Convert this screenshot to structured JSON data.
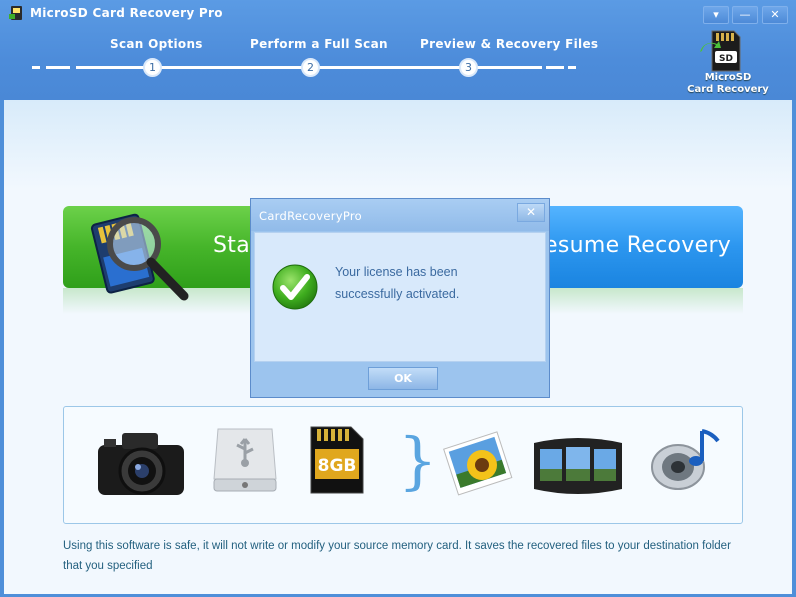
{
  "window": {
    "title": "MicroSD Card Recovery Pro",
    "controls": {
      "menu": "▾",
      "minimize": "—",
      "close": "✕"
    }
  },
  "wizard": {
    "steps": [
      {
        "label": "Scan Options",
        "number": "1"
      },
      {
        "label": "Perform a Full Scan",
        "number": "2"
      },
      {
        "label": "Preview & Recovery Files",
        "number": "3"
      }
    ]
  },
  "product": {
    "line1": "MicroSD",
    "line2": "Card Recovery",
    "logo_text": "SD"
  },
  "actions": {
    "start_label": "Sta",
    "resume_label": "esume Recovery"
  },
  "media": {
    "sd_card_capacity": "8GB",
    "items": [
      "camera-icon",
      "usb-drive-icon",
      "sd-card-icon",
      "photo-icon",
      "film-icon",
      "audio-icon"
    ]
  },
  "notice": "Using this software is safe, it will not write or modify your source memory card. It saves the recovered files to your destination folder that you specified",
  "dialog": {
    "title": "CardRecoveryPro",
    "close": "✕",
    "message_line1": "Your license has been",
    "message_line2": "successfully activated.",
    "ok_label": "OK"
  },
  "colors": {
    "header_blue": "#4d8cda",
    "start_green": "#46b52a",
    "resume_blue": "#2c96ef",
    "notice_text": "#23607f"
  }
}
